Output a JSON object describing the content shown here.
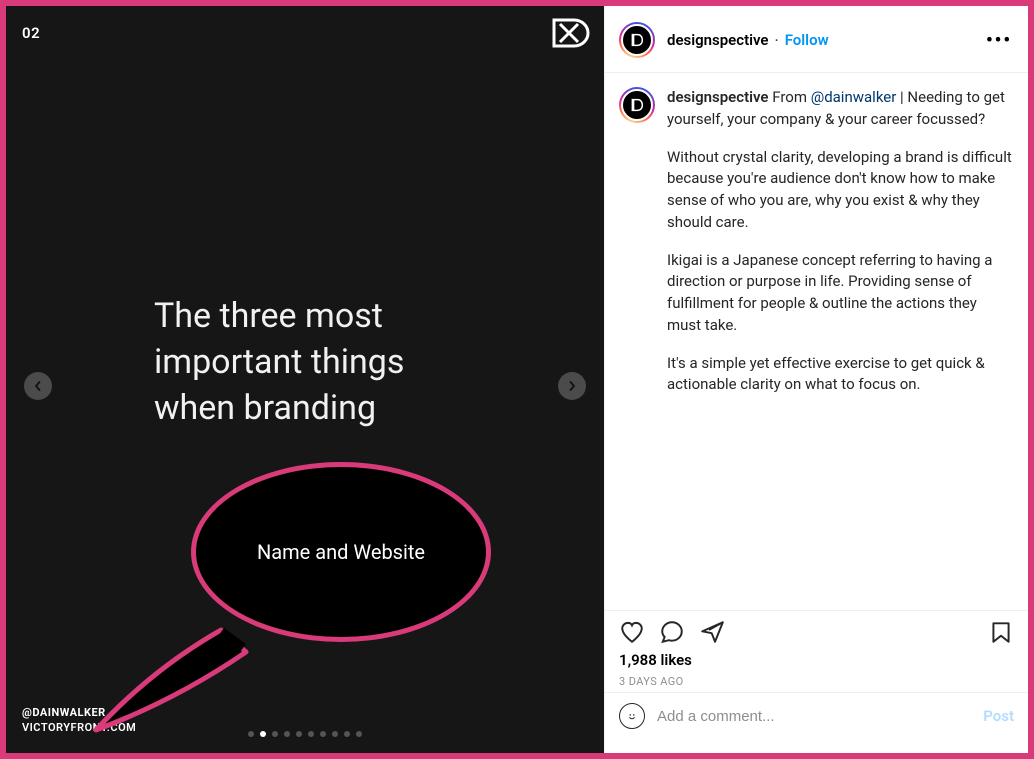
{
  "slide": {
    "number": "02",
    "headline": "The three most\nimportant things\nwhen branding",
    "handle": "@DAINWALKER",
    "website": "VICTORYFRONT.COM",
    "dot_count": 10,
    "active_dot_index": 1
  },
  "callout": {
    "text": "Name and Website"
  },
  "header": {
    "username": "designspective",
    "separator": "·",
    "follow_label": "Follow",
    "more_label": "•••"
  },
  "caption": {
    "username": "designspective",
    "lead_prefix": "From ",
    "mention": "@dainwalker",
    "lead_suffix": " | Needing to get yourself, your company & your career focussed?",
    "paragraphs": [
      "Without crystal clarity, developing a brand is difficult because you're audience don't know how to make sense of who you are, why you exist & why they should care.",
      "Ikigai is a Japanese concept referring to having a direction or purpose in life. Providing sense of fulfillment for people & outline the actions they must take.",
      "It's a simple yet effective exercise to get quick & actionable clarity on what to focus on."
    ]
  },
  "actions": {
    "likes_count": "1,988",
    "likes_suffix": " likes",
    "timestamp": "3 days ago"
  },
  "comment": {
    "placeholder": "Add a comment...",
    "post_label": "Post"
  }
}
